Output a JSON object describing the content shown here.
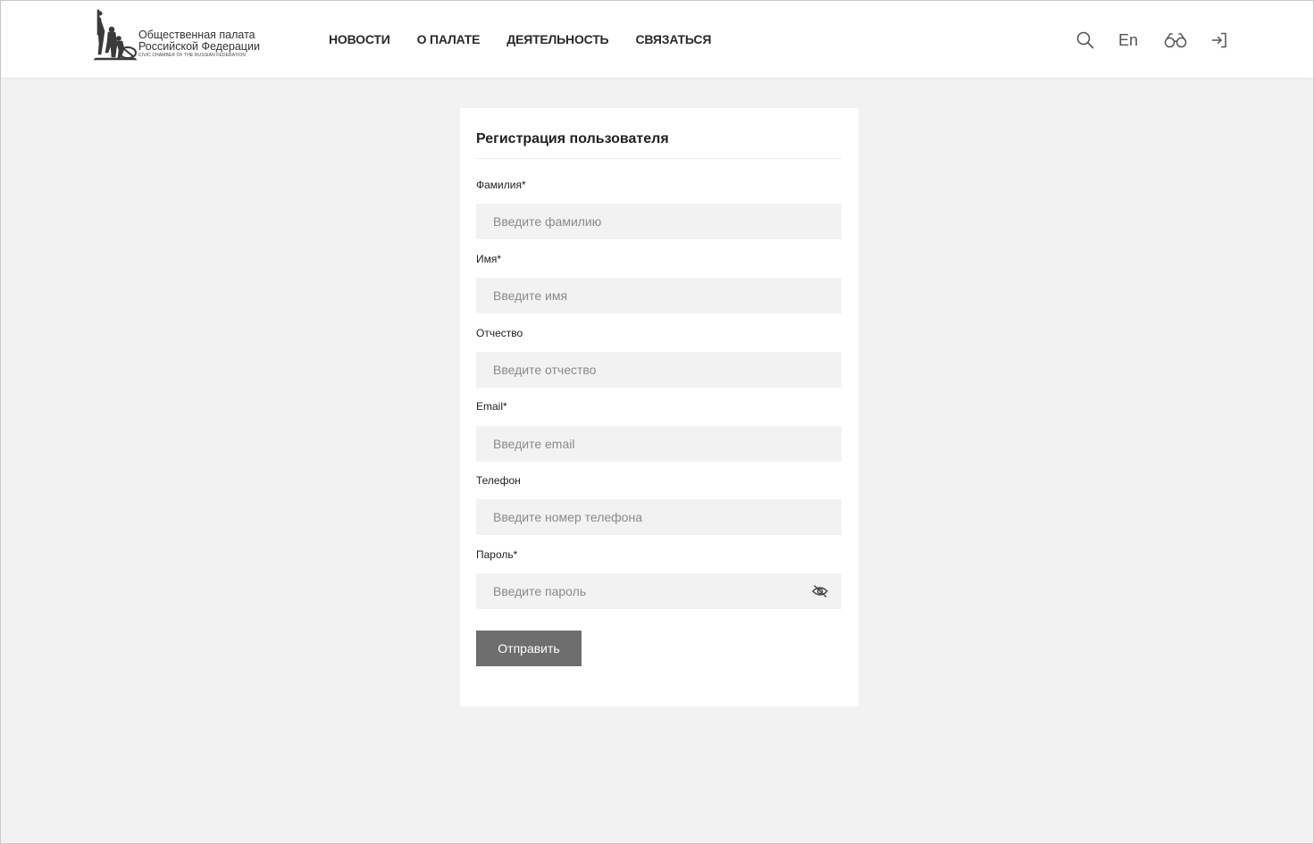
{
  "header": {
    "logo": {
      "line1": "Общественная палата",
      "line2": "Российской Федерации",
      "line3": "CIVIC CHAMBER OF THE RUSSIAN FEDERATION"
    },
    "nav": [
      {
        "label": "НОВОСТИ"
      },
      {
        "label": "О ПАЛАТЕ"
      },
      {
        "label": "ДЕЯТЕЛЬНОСТЬ"
      },
      {
        "label": "СВЯЗАТЬСЯ"
      }
    ],
    "actions": {
      "search_icon": "search-icon",
      "lang_label": "En",
      "accessibility_icon": "glasses-icon",
      "login_icon": "login-icon"
    }
  },
  "form": {
    "title": "Регистрация пользователя",
    "fields": [
      {
        "label": "Фамилия*",
        "placeholder": "Введите фамилию",
        "value": ""
      },
      {
        "label": "Имя*",
        "placeholder": "Введите имя",
        "value": ""
      },
      {
        "label": "Отчество",
        "placeholder": "Введите отчество",
        "value": ""
      },
      {
        "label": "Email*",
        "placeholder": "Введите email",
        "value": ""
      },
      {
        "label": "Телефон",
        "placeholder": "Введите номер телефона",
        "value": ""
      },
      {
        "label": "Пароль*",
        "placeholder": "Введите пароль",
        "value": ""
      }
    ],
    "password_toggle_icon": "eye-slash-icon",
    "submit_label": "Отправить"
  },
  "colors": {
    "page_background": "#f2f2f2",
    "card_background": "#ffffff",
    "input_background": "#f2f2f2",
    "button_background": "#6e6e6e",
    "button_text": "#ffffff"
  }
}
